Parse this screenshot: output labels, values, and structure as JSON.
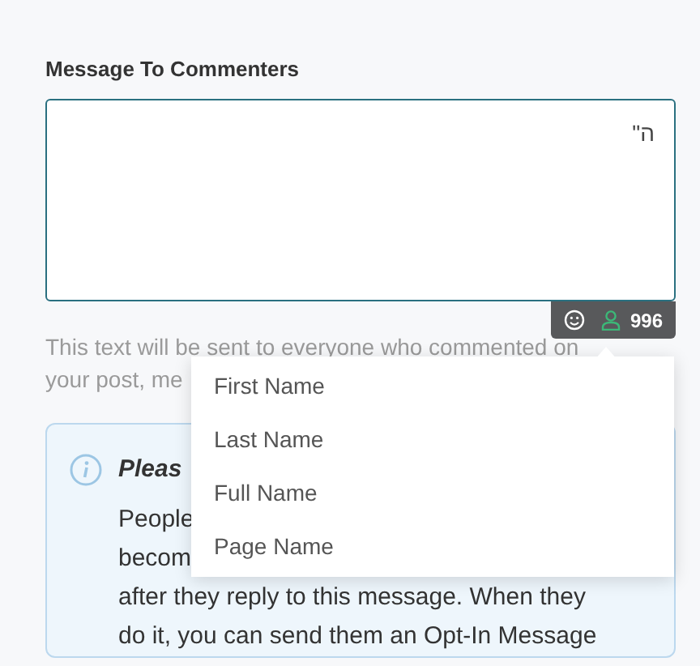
{
  "label": "Message To Commenters",
  "message": {
    "value": "ה\""
  },
  "toolbar": {
    "count": "996"
  },
  "hint_lines": [
    "This text will be sent to everyone who commented on",
    "your post, me"
  ],
  "menu": {
    "items": [
      {
        "label": "First Name"
      },
      {
        "label": "Last Name"
      },
      {
        "label": "Full Name"
      },
      {
        "label": "Page Name"
      }
    ]
  },
  "info": {
    "title": "Pleas",
    "lines": [
      "People",
      "becom",
      "after they reply to this message. When they",
      "do it, you can send them an Opt-In Message"
    ]
  }
}
